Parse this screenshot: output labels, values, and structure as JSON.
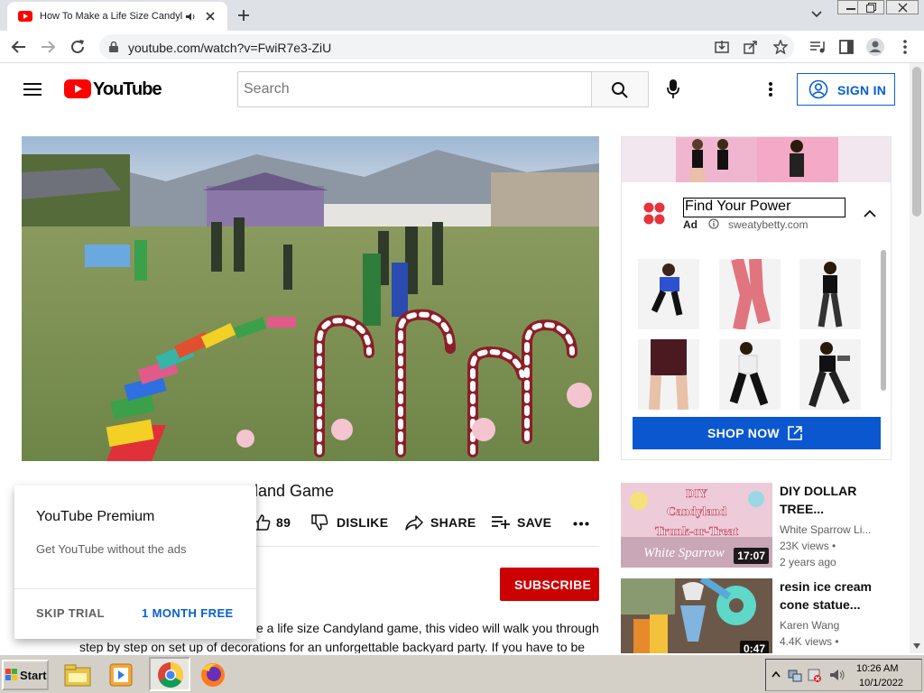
{
  "browser": {
    "tab_title": "How To Make a Life Size Candyland Game",
    "url": "youtube.com/watch?v=FwiR7e3-ZiU"
  },
  "youtube": {
    "logo": "YouTube",
    "search_placeholder": "Search",
    "signin_label": "SIGN IN"
  },
  "video": {
    "title_visible": "land Game",
    "likes": "89",
    "dislike_label": "DISLIKE",
    "share_label": "SHARE",
    "save_label": "SAVE",
    "subscribe_label": "SUBSCRIBE",
    "description_line1": "e a life size Candyland game, this video will walk you through",
    "description_line2": "step by step on set up of decorations for an unforgettable backyard party. If you have to be"
  },
  "premium_popup": {
    "title": "YouTube Premium",
    "subtitle": "Get YouTube without the ads",
    "skip_label": "SKIP TRIAL",
    "trial_label": "1 MONTH FREE"
  },
  "ad": {
    "headline": "Find Your Power",
    "label": "Ad",
    "domain": "sweatybetty.com",
    "cta": "SHOP NOW"
  },
  "recommendations": [
    {
      "title_line1": "DIY DOLLAR",
      "title_line2": "TREE...",
      "channel": "White Sparrow Li...",
      "views": "23K views",
      "age": "2 years ago",
      "duration": "17:07",
      "thumb_text1": "DIY",
      "thumb_text2": "Candyland",
      "thumb_text3": "Trunk-or-Treat",
      "thumb_text4": "White Sparrow"
    },
    {
      "title_line1": "resin ice cream",
      "title_line2": "cone statue...",
      "channel": "Karen Wang",
      "views": "4.4K views",
      "age": "",
      "duration": "0:47"
    }
  ],
  "taskbar": {
    "start_label": "Start",
    "time": "10:26 AM",
    "date": "10/1/2022"
  },
  "colors": {
    "youtube_red": "#ff0000",
    "subscribe_red": "#cc0000",
    "link_blue": "#065fd4",
    "shop_blue": "#0b57d0"
  }
}
